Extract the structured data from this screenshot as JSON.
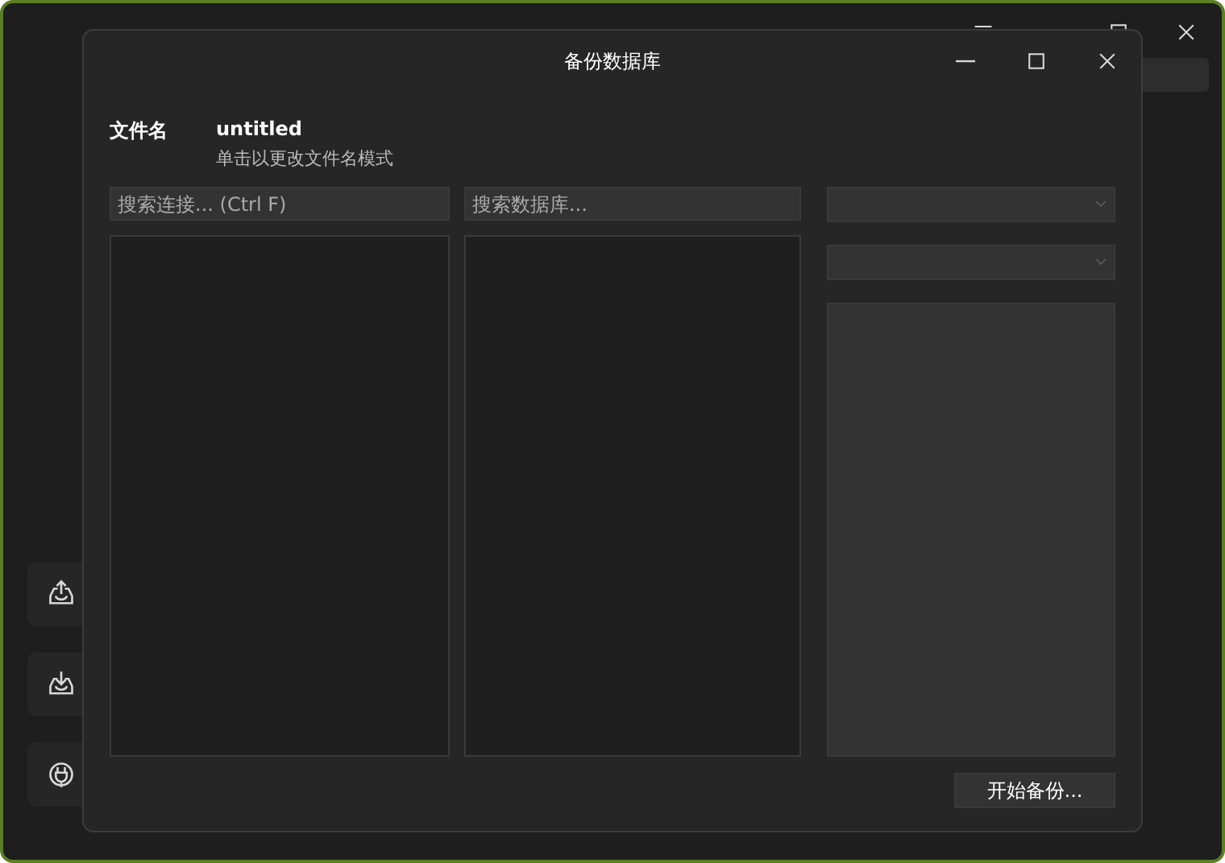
{
  "dialog": {
    "title": "备份数据库",
    "file_name": {
      "label": "文件名",
      "value": "untitled",
      "hint": "单击以更改文件名模式"
    },
    "connection_search": {
      "placeholder": "搜索连接... (Ctrl F)"
    },
    "database_search": {
      "placeholder": "搜索数据库..."
    },
    "dropdowns": [
      {
        "kind": "select"
      },
      {
        "kind": "select"
      }
    ],
    "start_button": {
      "label": "开始备份..."
    }
  }
}
